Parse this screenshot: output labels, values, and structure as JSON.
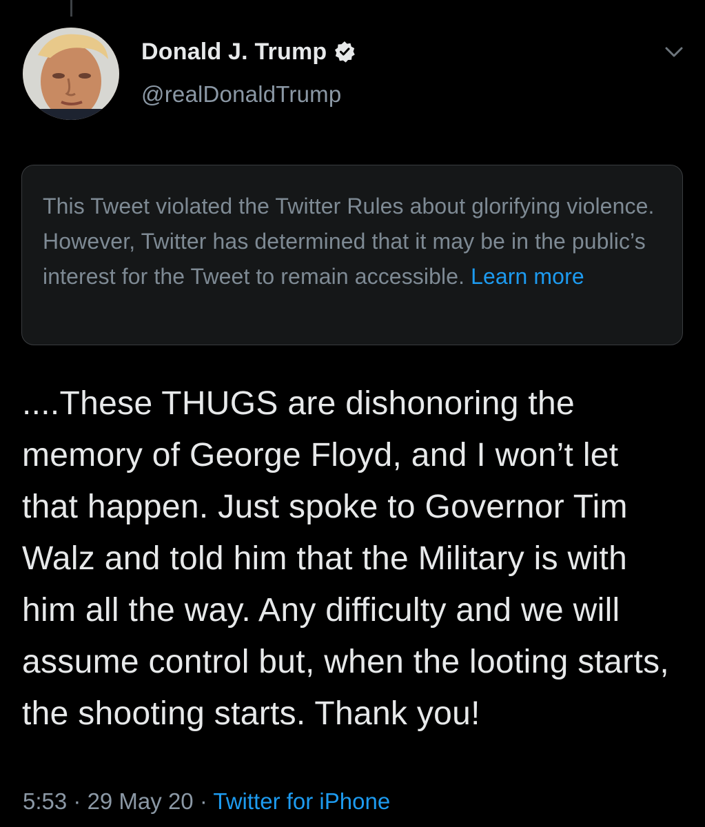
{
  "author": {
    "name": "Donald J. Trump",
    "handle": "@realDonaldTrump",
    "verified_icon": "verified-badge-icon",
    "avatar_icon": "profile-photo"
  },
  "menu": {
    "icon": "chevron-down-icon"
  },
  "notice": {
    "text": "This Tweet violated the Twitter Rules about glorifying violence. However, Twitter has determined that it may be in the public’s interest for the Tweet to remain accessible. ",
    "link_label": "Learn more"
  },
  "tweet": {
    "text": "....These THUGS are dishonoring the memory of George Floyd, and I won’t let that happen. Just spoke to Governor Tim Walz and told him that the Military is with him all the way. Any difficulty and we will assume control but, when the looting starts, the shooting starts. Thank you!"
  },
  "meta": {
    "time": "5:53",
    "separator": " · ",
    "date": "29 May 20",
    "source": "Twitter for iPhone"
  },
  "colors": {
    "background": "#000000",
    "link": "#1d9bf0",
    "muted": "#8b98a5",
    "text": "#e7e9ea",
    "notice_bg": "#151718"
  }
}
